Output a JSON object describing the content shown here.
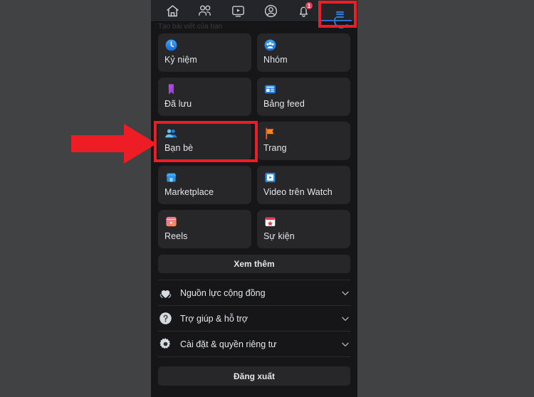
{
  "colors": {
    "page_bg": "#414244",
    "screen_bg": "#161618",
    "card_bg": "#272729",
    "nav_bg": "#242528",
    "text": "#e4e6eb",
    "annotation_red": "#ee1c25",
    "badge_red": "#e4405a",
    "accent_blue": "#2d6fd0"
  },
  "topnav": {
    "items": [
      {
        "name": "home-icon",
        "label": "Trang chủ",
        "badge": null
      },
      {
        "name": "friends-icon",
        "label": "Bạn bè",
        "badge": null
      },
      {
        "name": "watch-icon",
        "label": "Watch",
        "badge": null
      },
      {
        "name": "profile-icon",
        "label": "Trang cá nhân",
        "badge": null
      },
      {
        "name": "notifications-bell-icon",
        "label": "Thông báo",
        "badge": "1"
      },
      {
        "name": "menu-icon",
        "label": "Menu",
        "badge": null
      }
    ],
    "active_item": "menu-icon"
  },
  "ghost_text": "Tạo bài viết của bạn",
  "grid": {
    "tiles": [
      {
        "icon": "memories-clock-icon",
        "label": "Kỷ niệm",
        "highlighted": false
      },
      {
        "icon": "groups-people-icon",
        "label": "Nhóm",
        "highlighted": false
      },
      {
        "icon": "saved-bookmark-icon",
        "label": "Đã lưu",
        "highlighted": false
      },
      {
        "icon": "feeds-board-icon",
        "label": "Bảng feed",
        "highlighted": false
      },
      {
        "icon": "friends-people-icon",
        "label": "Bạn bè",
        "highlighted": true
      },
      {
        "icon": "pages-flag-icon",
        "label": "Trang",
        "highlighted": false
      },
      {
        "icon": "marketplace-store-icon",
        "label": "Marketplace",
        "highlighted": false
      },
      {
        "icon": "watch-video-icon",
        "label": "Video trên Watch",
        "highlighted": false
      },
      {
        "icon": "reels-clapper-icon",
        "label": "Reels",
        "highlighted": false
      },
      {
        "icon": "events-calendar-icon",
        "label": "Sự kiện",
        "highlighted": false
      }
    ],
    "see_more_label": "Xem thêm"
  },
  "menu_rows": [
    {
      "icon": "community-heart-hands-icon",
      "label": "Nguồn lực cộng đồng",
      "chevron": "chevron-down-icon"
    },
    {
      "icon": "help-question-icon",
      "label": "Trợ giúp & hỗ trợ",
      "chevron": "chevron-down-icon"
    },
    {
      "icon": "settings-gear-icon",
      "label": "Cài đặt & quyền riêng tư",
      "chevron": "chevron-down-icon"
    }
  ],
  "logout_label": "Đăng xuất",
  "annotations": {
    "arrow": {
      "name": "red-arrow-pointer",
      "direction": "right",
      "points_to": "Bạn bè"
    },
    "friends_box": {
      "name": "red-highlight-box-friends"
    },
    "menu_box": {
      "name": "red-highlight-box-menu"
    }
  }
}
